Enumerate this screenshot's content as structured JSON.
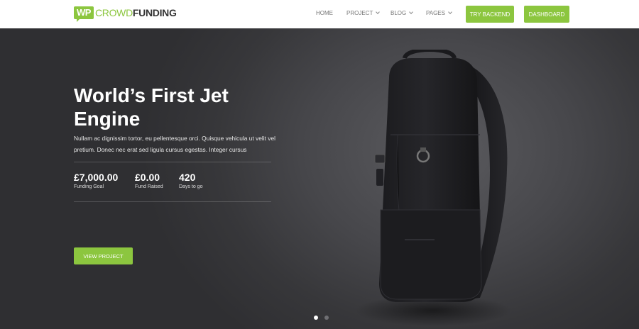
{
  "header": {
    "logo": {
      "badge": "WP",
      "light": "CROWD",
      "dark": "FUNDING"
    },
    "nav": [
      {
        "label": "HOME",
        "dropdown": false
      },
      {
        "label": "PROJECT",
        "dropdown": true
      },
      {
        "label": "BLOG",
        "dropdown": true
      },
      {
        "label": "PAGES",
        "dropdown": true
      }
    ],
    "try_backend_label": "TRY BACKEND",
    "dashboard_label": "DASHBOARD"
  },
  "hero": {
    "title": "World’s First Jet Engine",
    "description": "Nullam ac dignissim tortor, eu pellentesque orci. Quisque vehicula ut velit vel pretium. Donec nec erat sed ligula cursus egestas. Integer cursus",
    "stats": [
      {
        "value": "£7,000.00",
        "label": "Funding Goal"
      },
      {
        "value": "£0.00",
        "label": "Fund Raised"
      },
      {
        "value": "420",
        "label": "Days to go"
      }
    ],
    "cta_label": "VIEW PROJECT",
    "slides": {
      "count": 2,
      "active": 1
    }
  },
  "colors": {
    "accent": "#8cc63f",
    "header_bg": "#ffffff",
    "hero_bg": "#3a3a3d"
  },
  "icons": [
    "chevron-down-icon",
    "backpack-image"
  ]
}
